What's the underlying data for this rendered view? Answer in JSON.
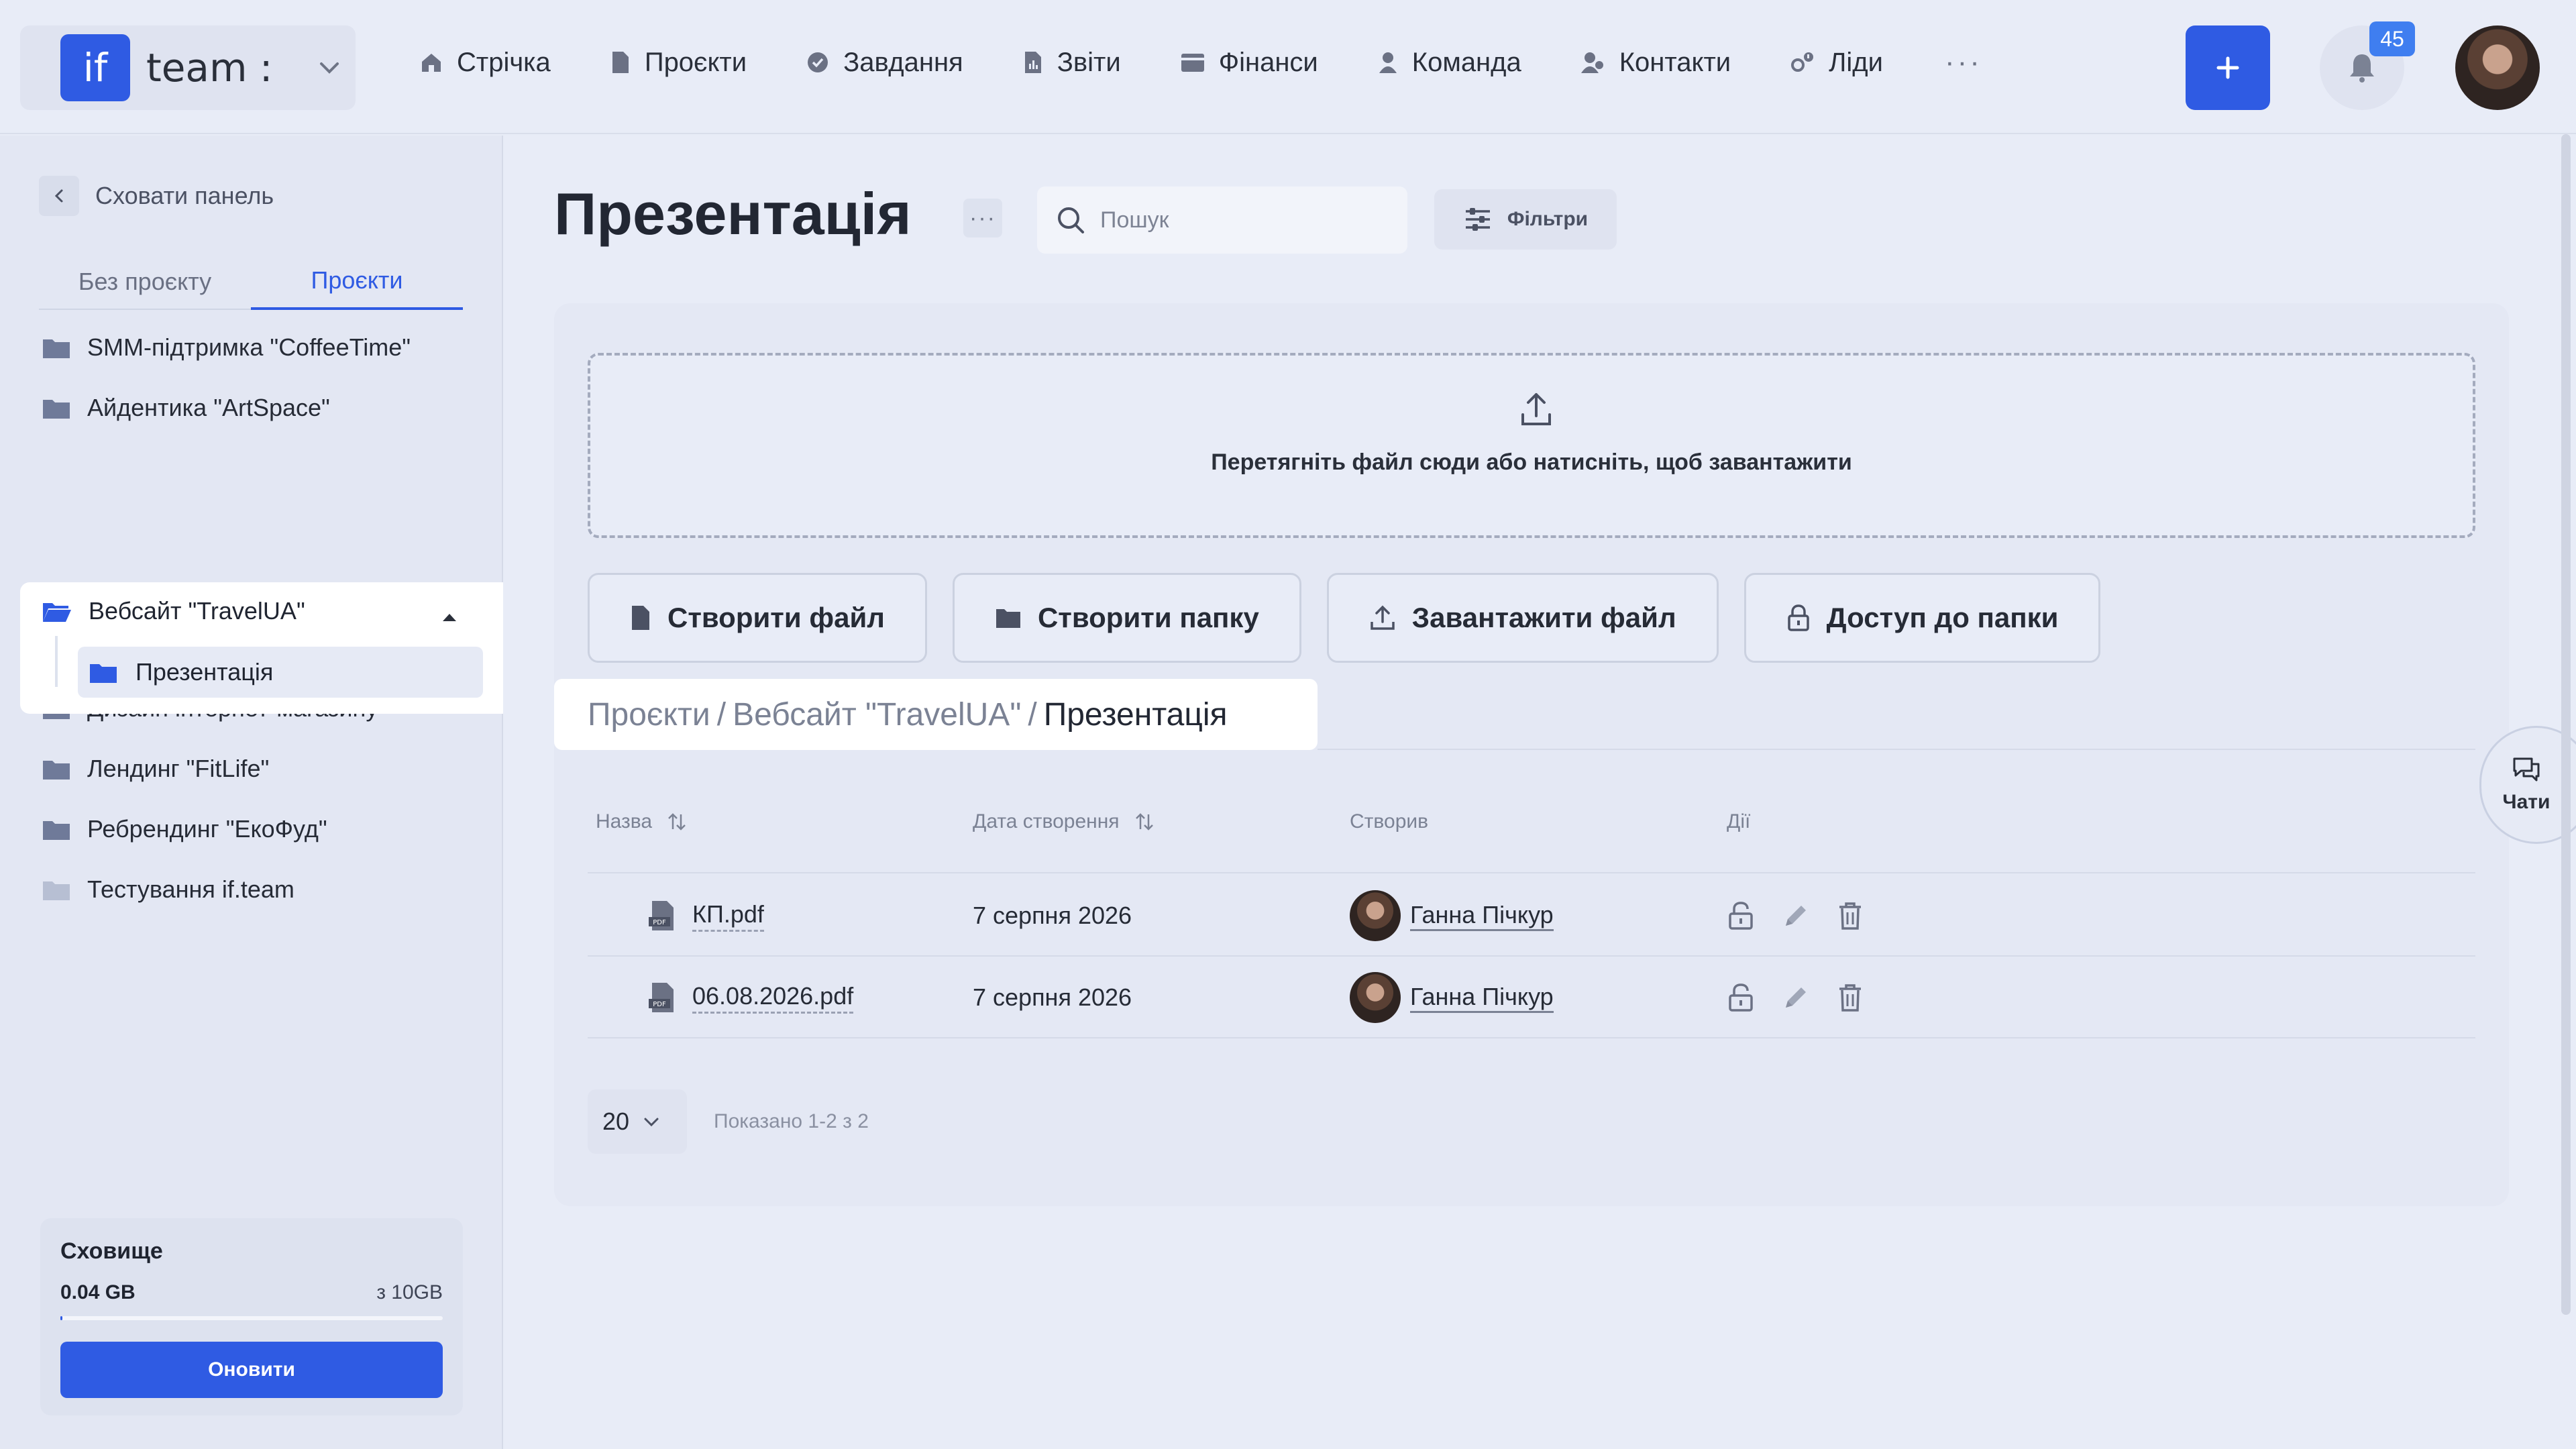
{
  "brand": {
    "logo_text": "if",
    "name": "team :"
  },
  "nav": [
    {
      "label": "Стрічка",
      "icon": "home-icon"
    },
    {
      "label": "Проєкти",
      "icon": "document-icon"
    },
    {
      "label": "Завдання",
      "icon": "check-circle-icon"
    },
    {
      "label": "Звіти",
      "icon": "report-icon"
    },
    {
      "label": "Фінанси",
      "icon": "wallet-icon"
    },
    {
      "label": "Команда",
      "icon": "user-icon"
    },
    {
      "label": "Контакти",
      "icon": "contacts-icon"
    },
    {
      "label": "Ліди",
      "icon": "leads-icon"
    }
  ],
  "header": {
    "more": "···",
    "notifications_count": "45"
  },
  "sidebar": {
    "hide_label": "Сховати панель",
    "tabs": [
      "Без проєкту",
      "Проєкти"
    ],
    "active_tab": "Проєкти",
    "folders": [
      "SMM-підтримка \"CoffeeTime\"",
      "Айдентика \"ArtSpace\"",
      "Вебсайт \"TravelUA\"",
      "Дизайн інтернет-магазину",
      "Лендинг \"FitLife\"",
      "Ребрендинг \"ЕкоФуд\"",
      "Тестування if.team"
    ],
    "active_folder": "Вебсайт \"TravelUA\"",
    "subfolder": "Презентація",
    "storage": {
      "title": "Сховище",
      "used": "0.04 GB",
      "total": "з 10GB",
      "used_fraction": 0.004,
      "button": "Оновити"
    }
  },
  "main": {
    "title": "Презентація",
    "title_more": "···",
    "search_placeholder": "Пошук",
    "filters_label": "Фільтри",
    "dropzone_text": "Перетягніть файл сюди або натисніть, щоб завантажити",
    "actions": {
      "create_file": "Створити файл",
      "create_folder": "Створити папку",
      "upload_file": "Завантажити файл",
      "folder_access": "Доступ до папки"
    },
    "breadcrumb": {
      "root": "Проєкти",
      "sep": "/",
      "parent": "Вебсайт \"TravelUA\"",
      "current": "Презентація"
    },
    "table": {
      "headers": {
        "name": "Назва",
        "created": "Дата створення",
        "author": "Створив",
        "actions": "Дії"
      },
      "rows": [
        {
          "name": "КП.pdf",
          "created": "7 серпня 2026",
          "author": "Ганна Пічкур"
        },
        {
          "name": "06.08.2026.pdf",
          "created": "7 серпня 2026",
          "author": "Ганна Пічкур"
        }
      ]
    },
    "pager": {
      "page_size": "20",
      "info": "Показано 1-2 з 2"
    }
  },
  "chat": {
    "label": "Чати"
  },
  "colors": {
    "accent": "#2f5be3",
    "background": "#e8ecf7",
    "badge": "#3f7ef0"
  }
}
